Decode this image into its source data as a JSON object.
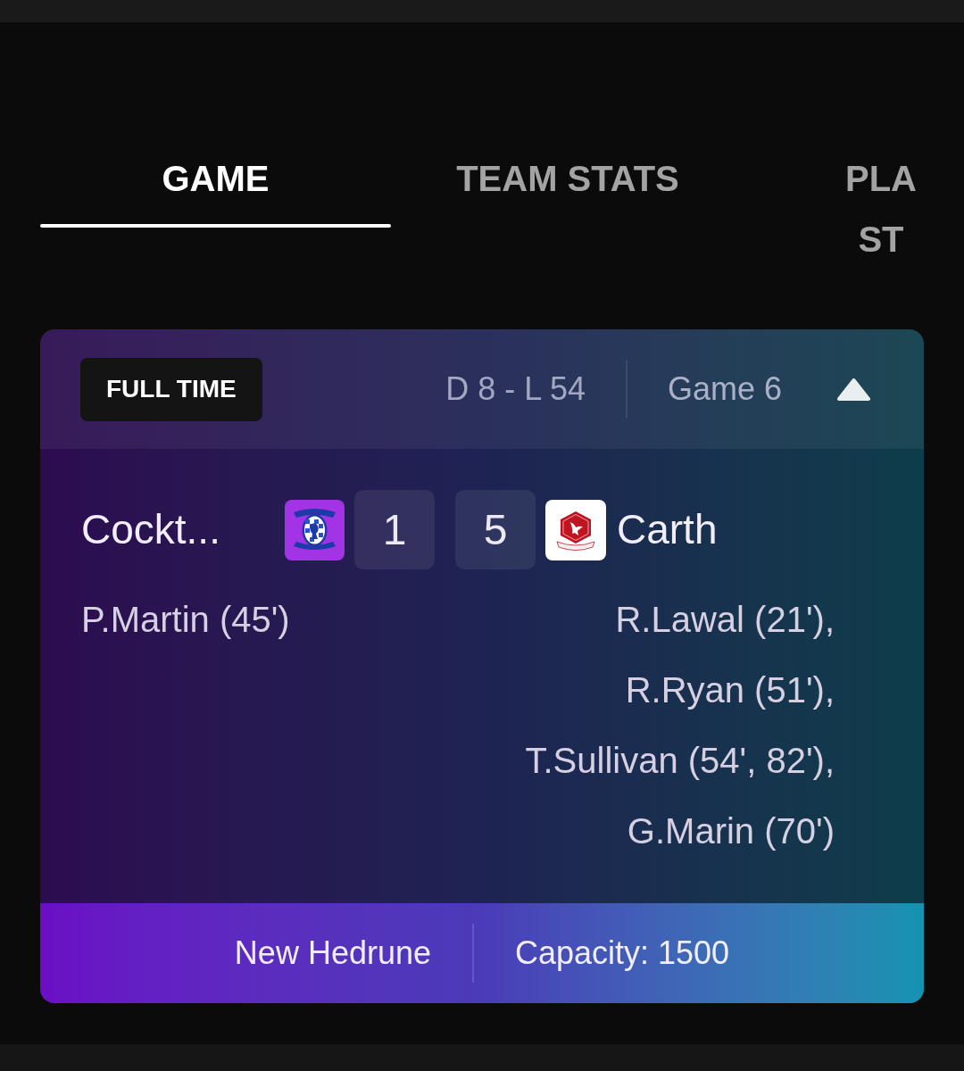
{
  "tabs": [
    {
      "label": "GAME",
      "selected": true
    },
    {
      "label": "TEAM STATS",
      "selected": false
    },
    {
      "label": "PLA ST",
      "selected": false
    }
  ],
  "match": {
    "status": "FULL TIME",
    "record": "D 8 - L 54",
    "game": "Game 6",
    "expanded": true,
    "home": {
      "name": "Cockt...",
      "score": "1",
      "scorers": [
        "P.Martin (45')"
      ]
    },
    "away": {
      "name": "Carth",
      "score": "5",
      "scorers": [
        "R.Lawal (21'),",
        "R.Ryan (51'),",
        "T.Sullivan (54', 82'),",
        "G.Marin (70')"
      ]
    },
    "venue": "New Hedrune",
    "capacity": "Capacity: 1500"
  }
}
